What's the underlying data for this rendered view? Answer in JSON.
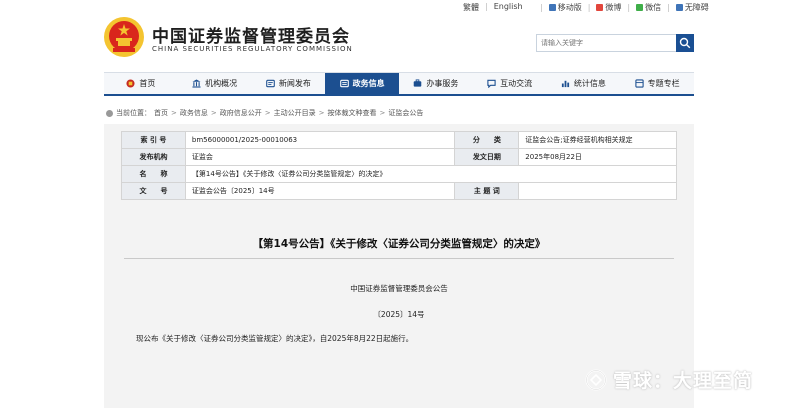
{
  "topbar": {
    "lang_traditional": "繁體",
    "lang_english": "English",
    "mobile": "移动版",
    "weibo": "微博",
    "wechat": "微信",
    "accessibility": "无障碍"
  },
  "header": {
    "title": "中国证券监督管理委员会",
    "subtitle": "CHINA SECURITIES REGULATORY COMMISSION",
    "search_placeholder": "请输入关键字"
  },
  "nav": {
    "items": [
      {
        "label": "首页",
        "icon": "home-icon"
      },
      {
        "label": "机构概况",
        "icon": "building-icon"
      },
      {
        "label": "新闻发布",
        "icon": "news-icon"
      },
      {
        "label": "政务信息",
        "icon": "info-icon",
        "active": true
      },
      {
        "label": "办事服务",
        "icon": "service-icon"
      },
      {
        "label": "互动交流",
        "icon": "chat-icon"
      },
      {
        "label": "统计信息",
        "icon": "stats-icon"
      },
      {
        "label": "专题专栏",
        "icon": "topic-icon"
      }
    ]
  },
  "breadcrumb": {
    "prefix": "当前位置：",
    "items": [
      "首页",
      "政务信息",
      "政府信息公开",
      "主动公开目录",
      "按体裁文种查看",
      "证监会公告"
    ]
  },
  "meta": {
    "index_label": "索 引 号",
    "index_value": "bm56000001/2025-00010063",
    "category_label": "分　　类",
    "category_value": "证监会公告;证券经营机构相关规定",
    "issuer_label": "发布机构",
    "issuer_value": "证监会",
    "date_label": "发文日期",
    "date_value": "2025年08月22日",
    "name_label": "名　　称",
    "name_value": "【第14号公告】《关于修改〈证券公司分类监管规定〉的决定》",
    "docno_label": "文　　号",
    "docno_value": "证监会公告〔2025〕14号",
    "subject_label": "主 题 词",
    "subject_value": ""
  },
  "document": {
    "title": "【第14号公告】《关于修改〈证券公司分类监管规定〉的决定》",
    "issuer": "中国证券监督管理委员会公告",
    "number": "〔2025〕14号",
    "paragraph": "现公布《关于修改〈证券公司分类监管规定〉的决定》，自2025年8月22日起施行。"
  },
  "watermark": {
    "text": "雪球：大理至简"
  },
  "colors": {
    "nav_active": "#1c4f90",
    "search_button": "#1a4f93",
    "emblem_red": "#d9261c",
    "emblem_gold": "#f4c430"
  }
}
